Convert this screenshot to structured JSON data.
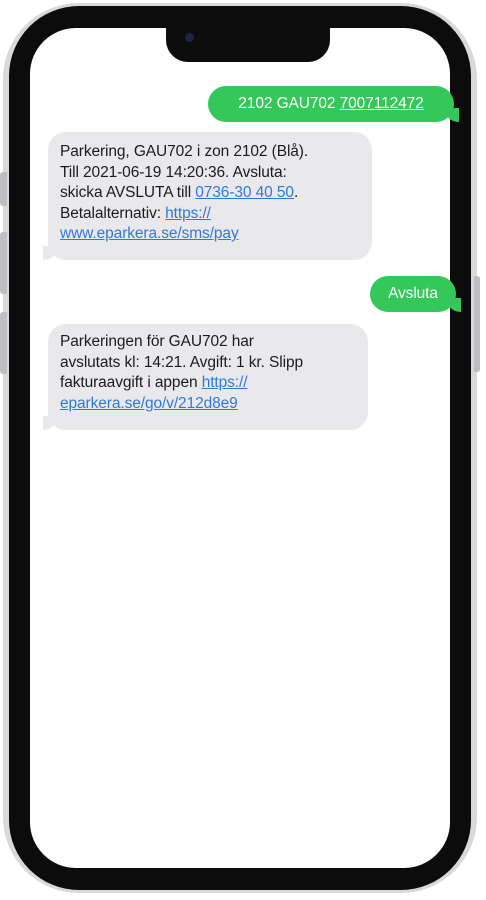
{
  "messages": [
    {
      "direction": "outgoing",
      "text": "2102 GAU702 ",
      "link": "7007112472"
    },
    {
      "direction": "incoming",
      "line1": "Parkering, GAU702 i zon 2102 (Blå).",
      "line2": "Till 2021-06-19 14:20:36. Avsluta:",
      "line3_prefix": "skicka AVSLUTA till ",
      "phone_link": "0736-30 40 50",
      "line3_suffix": ".",
      "line4_prefix": "Betalalternativ: ",
      "url_part1": "https://",
      "url_part2": "www.eparkera.se/sms/pay"
    },
    {
      "direction": "outgoing",
      "text": "Avsluta"
    },
    {
      "direction": "incoming",
      "line1": "Parkeringen för GAU702 har",
      "line2": "avslutats kl: 14:21. Avgift: 1 kr. Slipp",
      "line3_prefix": "fakturaavgift i appen ",
      "url_part1": "https://",
      "url_part2": "eparkera.se/go/v/212d8e9"
    }
  ],
  "colors": {
    "outgoing_bubble": "#34c759",
    "incoming_bubble": "#e9e9eb",
    "link": "#2f7ad6",
    "frame": "#0c0c0c"
  }
}
